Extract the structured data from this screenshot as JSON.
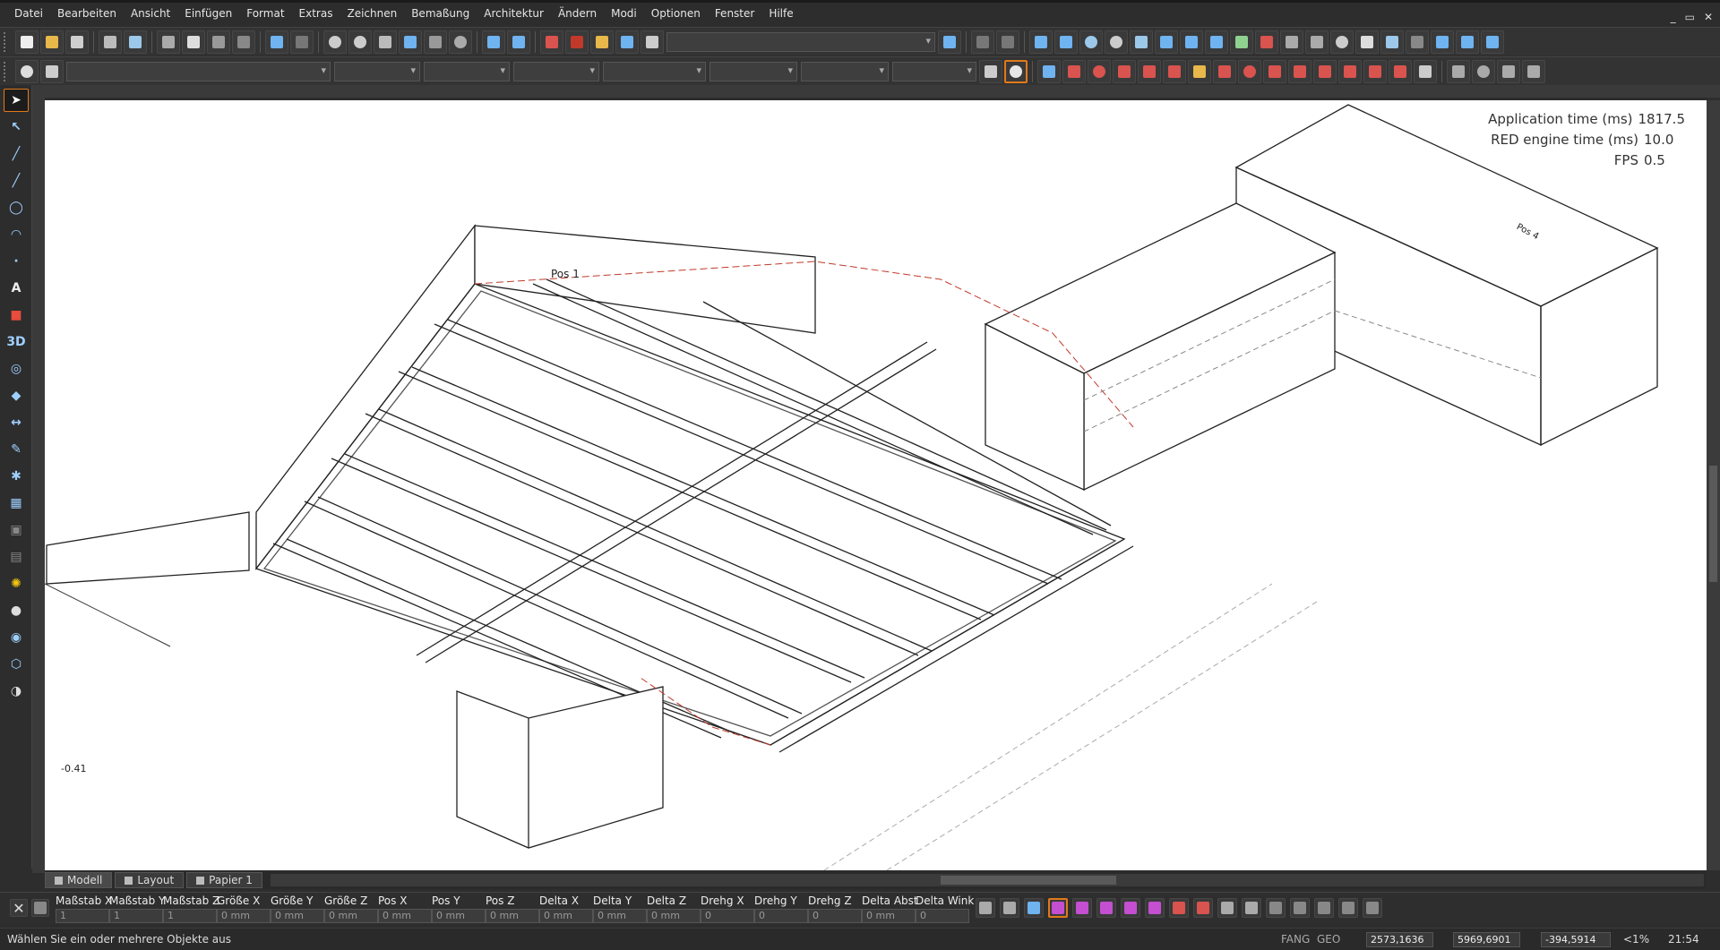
{
  "menu": [
    "Datei",
    "Bearbeiten",
    "Ansicht",
    "Einfügen",
    "Format",
    "Extras",
    "Zeichnen",
    "Bemaßung",
    "Architektur",
    "Ändern",
    "Modi",
    "Optionen",
    "Fenster",
    "Hilfe"
  ],
  "window_controls": [
    "_",
    "▭",
    "✕"
  ],
  "viewport": {
    "stats": [
      {
        "label": "Application time (ms)",
        "value": "1817.5"
      },
      {
        "label": "RED engine time (ms)",
        "value": "10.0"
      },
      {
        "label": "FPS",
        "value": "0.5"
      }
    ],
    "drawing_labels": {
      "pos1": "Pos 1",
      "pos4": "Pos 4",
      "corner_coord": "-0.41"
    }
  },
  "tabs": [
    {
      "label": "Modell",
      "active": true
    },
    {
      "label": "Layout",
      "active": false
    },
    {
      "label": "Papier 1",
      "active": false
    }
  ],
  "properties": [
    {
      "label": "Maßstab X",
      "value": "1"
    },
    {
      "label": "Maßstab Y",
      "value": "1"
    },
    {
      "label": "Maßstab Z",
      "value": "1"
    },
    {
      "label": "Größe X",
      "value": "0 mm"
    },
    {
      "label": "Größe Y",
      "value": "0 mm"
    },
    {
      "label": "Größe Z",
      "value": "0 mm"
    },
    {
      "label": "Pos X",
      "value": "0 mm"
    },
    {
      "label": "Pos Y",
      "value": "0 mm"
    },
    {
      "label": "Pos Z",
      "value": "0 mm"
    },
    {
      "label": "Delta X",
      "value": "0 mm"
    },
    {
      "label": "Delta Y",
      "value": "0 mm"
    },
    {
      "label": "Delta Z",
      "value": "0 mm"
    },
    {
      "label": "Drehg X",
      "value": "0"
    },
    {
      "label": "Drehg Y",
      "value": "0"
    },
    {
      "label": "Drehg Z",
      "value": "0"
    },
    {
      "label": "Delta Abst",
      "value": "0 mm"
    },
    {
      "label": "Delta Wink",
      "value": "0"
    }
  ],
  "status": {
    "message": "Wählen Sie ein oder mehrere Objekte aus",
    "fang": "FANG",
    "geo": "GEO",
    "x": "2573,1636 mm",
    "y": "5969,6901 mm",
    "z": "-394,5914 mm",
    "angle": "<1%",
    "time": "21:54"
  },
  "colors": {
    "accent": "#e07a1a",
    "toolbar_bg": "#333333",
    "viewport_bg": "#ffffff",
    "hidden_line": "#c0392b"
  }
}
